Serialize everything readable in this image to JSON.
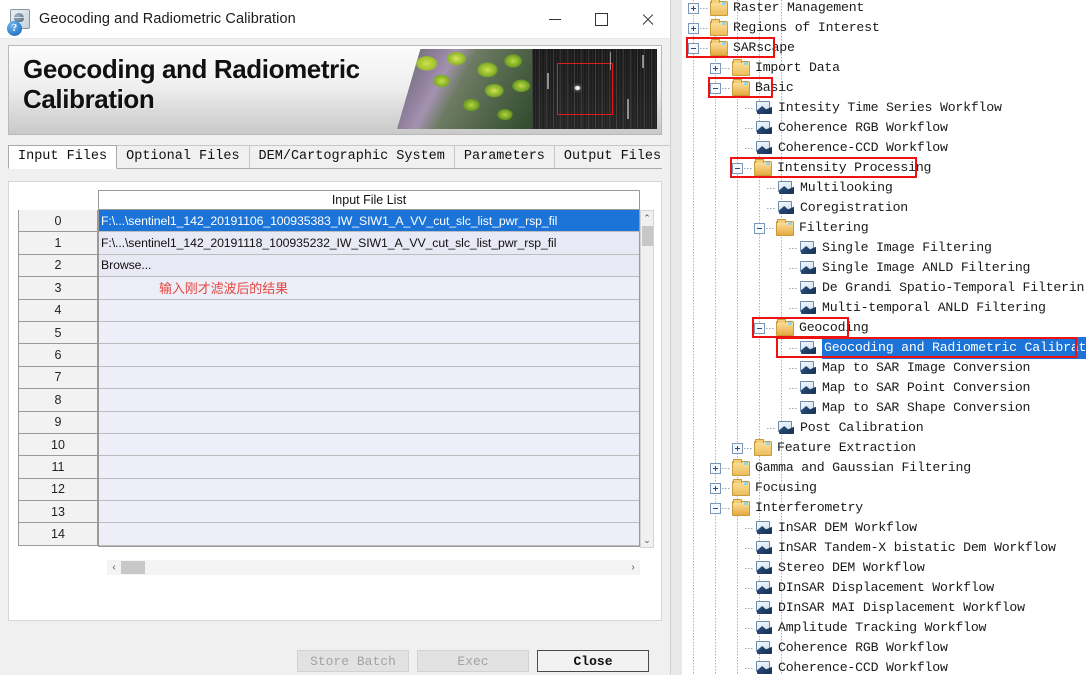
{
  "window": {
    "title": "Geocoding and Radiometric Calibration",
    "icon": "app-globe-icon",
    "minimize_label": "—",
    "maximize_label": "□",
    "close_label": "✕"
  },
  "banner": {
    "heading": "Geocoding and Radiometric Calibration"
  },
  "tabs": [
    {
      "label": "Input Files",
      "active": true
    },
    {
      "label": "Optional Files",
      "active": false
    },
    {
      "label": "DEM/Cartographic System",
      "active": false
    },
    {
      "label": "Parameters",
      "active": false
    },
    {
      "label": "Output Files",
      "active": false
    }
  ],
  "file_list": {
    "header": "Input File List",
    "rows": [
      {
        "index": "0",
        "value": "F:\\...\\sentinel1_142_20191106_100935383_IW_SIW1_A_VV_cut_slc_list_pwr_rsp_fil",
        "state": "selected"
      },
      {
        "index": "1",
        "value": "F:\\...\\sentinel1_142_20191118_100935232_IW_SIW1_A_VV_cut_slc_list_pwr_rsp_fil",
        "state": "normal"
      },
      {
        "index": "2",
        "value": "Browse...",
        "state": "normal"
      },
      {
        "index": "3",
        "value": "",
        "state": "empty",
        "annotation": "输入刚才滤波后的结果"
      },
      {
        "index": "4",
        "value": "",
        "state": "empty"
      },
      {
        "index": "5",
        "value": "",
        "state": "empty"
      },
      {
        "index": "6",
        "value": "",
        "state": "empty"
      },
      {
        "index": "7",
        "value": "",
        "state": "empty"
      },
      {
        "index": "8",
        "value": "",
        "state": "empty"
      },
      {
        "index": "9",
        "value": "",
        "state": "empty"
      },
      {
        "index": "10",
        "value": "",
        "state": "empty"
      },
      {
        "index": "11",
        "value": "",
        "state": "empty"
      },
      {
        "index": "12",
        "value": "",
        "state": "empty"
      },
      {
        "index": "13",
        "value": "",
        "state": "empty"
      },
      {
        "index": "14",
        "value": "",
        "state": "empty"
      }
    ],
    "scroll_up": "⌃",
    "scroll_down": "⌄",
    "scroll_left": "‹",
    "scroll_right": "›"
  },
  "footer": {
    "help": "?",
    "store_batch": "Store Batch",
    "exec": "Exec",
    "close": "Close"
  },
  "colors": {
    "selection_blue": "#1c74d8",
    "annotation_red": "#e3473f",
    "highlight_box": "#ee1111"
  },
  "tree": {
    "nodes": [
      {
        "label": "Raster Management",
        "depth": 0,
        "icon": "folder-icon",
        "toggle": "plus",
        "selected": false,
        "highlighted": false
      },
      {
        "label": "Regions of Interest",
        "depth": 0,
        "icon": "folder-icon",
        "toggle": "plus",
        "selected": false,
        "highlighted": false
      },
      {
        "label": "SARscape",
        "depth": 0,
        "icon": "folder-open-icon",
        "toggle": "minus",
        "selected": false,
        "highlighted": true
      },
      {
        "label": "Import Data",
        "depth": 1,
        "icon": "folder-icon",
        "toggle": "plus",
        "selected": false,
        "highlighted": false
      },
      {
        "label": "Basic",
        "depth": 1,
        "icon": "folder-open-icon",
        "toggle": "minus",
        "selected": false,
        "highlighted": true
      },
      {
        "label": "Intesity Time Series Workflow",
        "depth": 2,
        "icon": "tool-icon",
        "toggle": "none",
        "selected": false,
        "highlighted": false
      },
      {
        "label": "Coherence RGB Workflow",
        "depth": 2,
        "icon": "tool-icon",
        "toggle": "none",
        "selected": false,
        "highlighted": false
      },
      {
        "label": "Coherence-CCD Workflow",
        "depth": 2,
        "icon": "tool-icon",
        "toggle": "none",
        "selected": false,
        "highlighted": false
      },
      {
        "label": "Intensity Processing",
        "depth": 2,
        "icon": "folder-open-icon",
        "toggle": "minus",
        "selected": false,
        "highlighted": true
      },
      {
        "label": "Multilooking",
        "depth": 3,
        "icon": "tool-icon",
        "toggle": "none",
        "selected": false,
        "highlighted": false
      },
      {
        "label": "Coregistration",
        "depth": 3,
        "icon": "tool-icon",
        "toggle": "none",
        "selected": false,
        "highlighted": false
      },
      {
        "label": "Filtering",
        "depth": 3,
        "icon": "folder-open-icon",
        "toggle": "minus",
        "selected": false,
        "highlighted": false
      },
      {
        "label": "Single Image Filtering",
        "depth": 4,
        "icon": "tool-icon",
        "toggle": "none",
        "selected": false,
        "highlighted": false
      },
      {
        "label": "Single Image ANLD Filtering",
        "depth": 4,
        "icon": "tool-icon",
        "toggle": "none",
        "selected": false,
        "highlighted": false
      },
      {
        "label": "De Grandi Spatio-Temporal Filterin",
        "depth": 4,
        "icon": "tool-icon",
        "toggle": "none",
        "selected": false,
        "highlighted": false
      },
      {
        "label": "Multi-temporal ANLD Filtering",
        "depth": 4,
        "icon": "tool-icon",
        "toggle": "none",
        "selected": false,
        "highlighted": false
      },
      {
        "label": "Geocoding",
        "depth": 3,
        "icon": "folder-open-icon",
        "toggle": "minus",
        "selected": false,
        "highlighted": true
      },
      {
        "label": "Geocoding and Radiometric Calibrat",
        "depth": 4,
        "icon": "tool-icon",
        "toggle": "none",
        "selected": true,
        "highlighted": true
      },
      {
        "label": "Map to SAR Image Conversion",
        "depth": 4,
        "icon": "tool-icon",
        "toggle": "none",
        "selected": false,
        "highlighted": false
      },
      {
        "label": "Map to SAR Point Conversion",
        "depth": 4,
        "icon": "tool-icon",
        "toggle": "none",
        "selected": false,
        "highlighted": false
      },
      {
        "label": "Map to SAR Shape Conversion",
        "depth": 4,
        "icon": "tool-icon",
        "toggle": "none",
        "selected": false,
        "highlighted": false
      },
      {
        "label": "Post Calibration",
        "depth": 3,
        "icon": "tool-icon",
        "toggle": "none",
        "selected": false,
        "highlighted": false
      },
      {
        "label": "Feature Extraction",
        "depth": 2,
        "icon": "folder-icon",
        "toggle": "plus",
        "selected": false,
        "highlighted": false
      },
      {
        "label": "Gamma and Gaussian Filtering",
        "depth": 1,
        "icon": "folder-icon",
        "toggle": "plus",
        "selected": false,
        "highlighted": false
      },
      {
        "label": "Focusing",
        "depth": 1,
        "icon": "folder-icon",
        "toggle": "plus",
        "selected": false,
        "highlighted": false
      },
      {
        "label": "Interferometry",
        "depth": 1,
        "icon": "folder-open-icon",
        "toggle": "minus",
        "selected": false,
        "highlighted": false
      },
      {
        "label": "InSAR DEM Workflow",
        "depth": 2,
        "icon": "tool-icon",
        "toggle": "none",
        "selected": false,
        "highlighted": false
      },
      {
        "label": "InSAR Tandem-X bistatic Dem Workflow",
        "depth": 2,
        "icon": "tool-icon",
        "toggle": "none",
        "selected": false,
        "highlighted": false
      },
      {
        "label": "Stereo DEM Workflow",
        "depth": 2,
        "icon": "tool-icon",
        "toggle": "none",
        "selected": false,
        "highlighted": false
      },
      {
        "label": "DInSAR Displacement Workflow",
        "depth": 2,
        "icon": "tool-icon",
        "toggle": "none",
        "selected": false,
        "highlighted": false
      },
      {
        "label": "DInSAR MAI Displacement Workflow",
        "depth": 2,
        "icon": "tool-icon",
        "toggle": "none",
        "selected": false,
        "highlighted": false
      },
      {
        "label": "Amplitude Tracking Workflow",
        "depth": 2,
        "icon": "tool-icon",
        "toggle": "none",
        "selected": false,
        "highlighted": false
      },
      {
        "label": "Coherence RGB Workflow",
        "depth": 2,
        "icon": "tool-icon",
        "toggle": "none",
        "selected": false,
        "highlighted": false
      },
      {
        "label": "Coherence-CCD Workflow",
        "depth": 2,
        "icon": "tool-icon",
        "toggle": "none",
        "selected": false,
        "highlighted": false
      }
    ]
  }
}
